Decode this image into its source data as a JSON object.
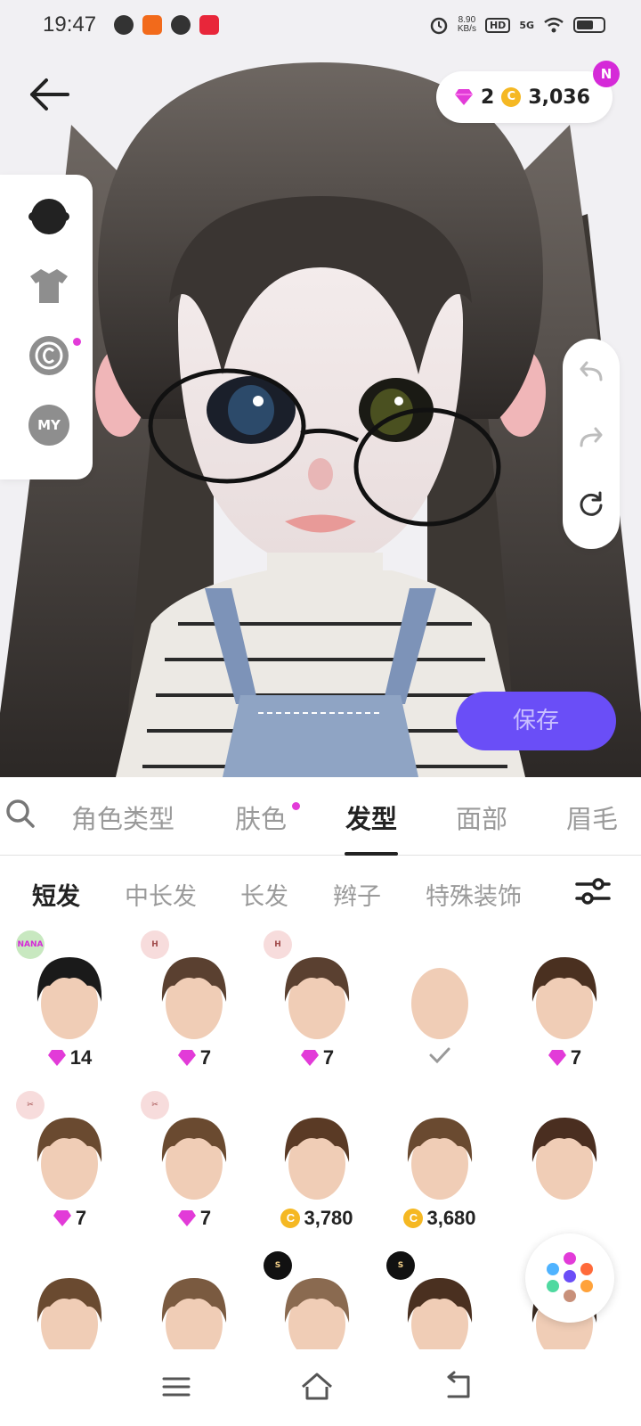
{
  "status_bar": {
    "time": "19:47",
    "net_speed_value": "8.90",
    "net_speed_unit": "KB/s",
    "hd_label": "HD",
    "signal_label": "5G"
  },
  "header": {
    "gems": "2",
    "coins": "3,036",
    "new_badge": "N",
    "coin_symbol": "C"
  },
  "left_panel": {
    "items": [
      {
        "icon": "head-icon"
      },
      {
        "icon": "shirt-icon"
      },
      {
        "icon": "copyright-icon"
      },
      {
        "icon": "my-icon",
        "label": "MY"
      }
    ]
  },
  "right_panel": {
    "items": [
      {
        "icon": "undo-icon"
      },
      {
        "icon": "redo-icon"
      },
      {
        "icon": "reset-icon"
      }
    ]
  },
  "save_button_label": "保存",
  "category_tabs": [
    {
      "label": "角色类型",
      "active": false
    },
    {
      "label": "肤色",
      "active": false
    },
    {
      "label": "发型",
      "active": true
    },
    {
      "label": "面部",
      "active": false
    },
    {
      "label": "眉毛",
      "active": false
    }
  ],
  "sub_tabs": [
    {
      "label": "短发",
      "active": true
    },
    {
      "label": "中长发",
      "active": false
    },
    {
      "label": "长发",
      "active": false
    },
    {
      "label": "辫子",
      "active": false
    },
    {
      "label": "特殊装饰",
      "active": false
    }
  ],
  "hair_items": [
    {
      "badge": "NANA",
      "price": "14",
      "currency": "gem",
      "hair_color": "#1a1a1a"
    },
    {
      "badge": "H",
      "price": "7",
      "currency": "gem",
      "hair_color": "#5a4030"
    },
    {
      "badge": "H",
      "price": "7",
      "currency": "gem",
      "hair_color": "#5a4030"
    },
    {
      "badge": "",
      "price": "",
      "currency": "selected",
      "hair_color": ""
    },
    {
      "badge": "",
      "price": "7",
      "currency": "gem",
      "hair_color": "#4a3020"
    },
    {
      "badge": "✂",
      "price": "7",
      "currency": "gem",
      "hair_color": "#6a4a30"
    },
    {
      "badge": "✂",
      "price": "7",
      "currency": "gem",
      "hair_color": "#6a4a30"
    },
    {
      "badge": "",
      "price": "3,780",
      "currency": "coin",
      "hair_color": "#5a3a25"
    },
    {
      "badge": "",
      "price": "3,680",
      "currency": "coin",
      "hair_color": "#6a4a30"
    },
    {
      "badge": "",
      "price": "",
      "currency": "none",
      "hair_color": "#4a2e20"
    },
    {
      "badge": "",
      "price": "",
      "currency": "none",
      "hair_color": "#6a4a30"
    },
    {
      "badge": "",
      "price": "",
      "currency": "none",
      "hair_color": "#7a5a40"
    },
    {
      "badge": "S",
      "price": "",
      "currency": "none",
      "hair_color": "#8a6a50"
    },
    {
      "badge": "S",
      "price": "",
      "currency": "none",
      "hair_color": "#4a3020"
    },
    {
      "badge": "",
      "price": "",
      "currency": "none",
      "hair_color": "#3a2a20"
    }
  ],
  "colors": {
    "accent": "#6a4ef7",
    "gem": "#e23bd8",
    "coin": "#f5b823",
    "notification_dot": "#e23bd8"
  }
}
